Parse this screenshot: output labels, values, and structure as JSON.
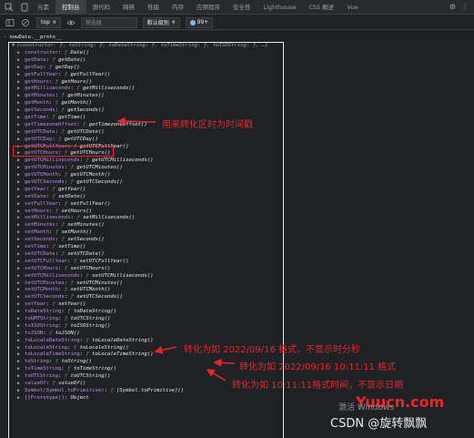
{
  "tabs": [
    {
      "label": "元素"
    },
    {
      "label": "控制台"
    },
    {
      "label": "源代码"
    },
    {
      "label": "网络"
    },
    {
      "label": "性能"
    },
    {
      "label": "内存"
    },
    {
      "label": "应用程序"
    },
    {
      "label": "安全性"
    },
    {
      "label": "Lighthouse"
    },
    {
      "label": "CSS 概述"
    },
    {
      "label": "Vue"
    }
  ],
  "active_tab_index": 1,
  "toolbar": {
    "context": "top",
    "filter_placeholder": "筛选器",
    "level": "默认级别",
    "issues_count": "99+"
  },
  "console": {
    "prompt": "nowDate.__proto__",
    "object_preview": "{constructor: ƒ, toString: ƒ, toDateString: ƒ, toTimeString: ƒ, toISOString: ƒ, …}",
    "entries": [
      {
        "key": "constructor",
        "val": "Date()"
      },
      {
        "key": "getDate",
        "val": "getDate()"
      },
      {
        "key": "getDay",
        "val": "getDay()"
      },
      {
        "key": "getFullYear",
        "val": "getFullYear()"
      },
      {
        "key": "getHours",
        "val": "getHours()"
      },
      {
        "key": "getMilliseconds",
        "val": "getMilliseconds()"
      },
      {
        "key": "getMinutes",
        "val": "getMinutes()"
      },
      {
        "key": "getMonth",
        "val": "getMonth()"
      },
      {
        "key": "getSeconds",
        "val": "getSeconds()"
      },
      {
        "key": "getTime",
        "val": "getTime()"
      },
      {
        "key": "getTimezoneOffset",
        "val": "getTimezoneOffset()"
      },
      {
        "key": "getUTCDate",
        "val": "getUTCDate()"
      },
      {
        "key": "getUTCDay",
        "val": "getUTCDay()"
      },
      {
        "key": "getUTCFullYear",
        "val": "getUTCFullYear()"
      },
      {
        "key": "getUTCHours",
        "val": "getUTCHours()"
      },
      {
        "key": "getUTCMilliseconds",
        "val": "getUTCMilliseconds()"
      },
      {
        "key": "getUTCMinutes",
        "val": "getUTCMinutes()"
      },
      {
        "key": "getUTCMonth",
        "val": "getUTCMonth()"
      },
      {
        "key": "getUTCSeconds",
        "val": "getUTCSeconds()"
      },
      {
        "key": "getYear",
        "val": "getYear()"
      },
      {
        "key": "setDate",
        "val": "setDate()"
      },
      {
        "key": "setFullYear",
        "val": "setFullYear()"
      },
      {
        "key": "setHours",
        "val": "setHours()"
      },
      {
        "key": "setMilliseconds",
        "val": "setMilliseconds()"
      },
      {
        "key": "setMinutes",
        "val": "setMinutes()"
      },
      {
        "key": "setMonth",
        "val": "setMonth()"
      },
      {
        "key": "setSeconds",
        "val": "setSeconds()"
      },
      {
        "key": "setTime",
        "val": "setTime()"
      },
      {
        "key": "setUTCDate",
        "val": "setUTCDate()"
      },
      {
        "key": "setUTCFullYear",
        "val": "setUTCFullYear()"
      },
      {
        "key": "setUTCHours",
        "val": "setUTCHours()"
      },
      {
        "key": "setUTCMilliseconds",
        "val": "setUTCMilliseconds()"
      },
      {
        "key": "setUTCMinutes",
        "val": "setUTCMinutes()"
      },
      {
        "key": "setUTCMonth",
        "val": "setUTCMonth()"
      },
      {
        "key": "setUTCSeconds",
        "val": "setUTCSeconds()"
      },
      {
        "key": "setYear",
        "val": "setYear()"
      },
      {
        "key": "toDateString",
        "val": "toDateString()"
      },
      {
        "key": "toGMTString",
        "val": "toUTCString()"
      },
      {
        "key": "toISOString",
        "val": "toISOString()"
      },
      {
        "key": "toJSON",
        "val": "toJSON()"
      },
      {
        "key": "toLocaleDateString",
        "val": "toLocaleDateString()"
      },
      {
        "key": "toLocaleString",
        "val": "toLocaleString()"
      },
      {
        "key": "toLocaleTimeString",
        "val": "toLocaleTimeString()"
      },
      {
        "key": "toString",
        "val": "toString()"
      },
      {
        "key": "toTimeString",
        "val": "toTimeString()"
      },
      {
        "key": "toUTCString",
        "val": "toUTCString()"
      },
      {
        "key": "valueOf",
        "val": "valueOf()"
      },
      {
        "key": "Symbol(Symbol.toPrimitive)",
        "val": "[Symbol.toPrimitive]()"
      },
      {
        "key": "[[Prototype]]",
        "val": "Object",
        "plain": true
      }
    ]
  },
  "annotations": {
    "get_time": "用来转化区时为时间戳",
    "locale_date": "转化为如 2022/09/16 格式，不显示时分秒",
    "locale_string": "转化为如 2022/09/16 10:11:11 格式",
    "locale_time": "转化为如 10:11:11格式时间，不显示日期"
  },
  "watermarks": {
    "site": "Yuucn.com",
    "windows": "激活 Windows",
    "csdn": "CSDN @旋转飘飘"
  },
  "colors": {
    "annotation": "#e8262c",
    "key": "#c58af9",
    "background": "#202124"
  }
}
